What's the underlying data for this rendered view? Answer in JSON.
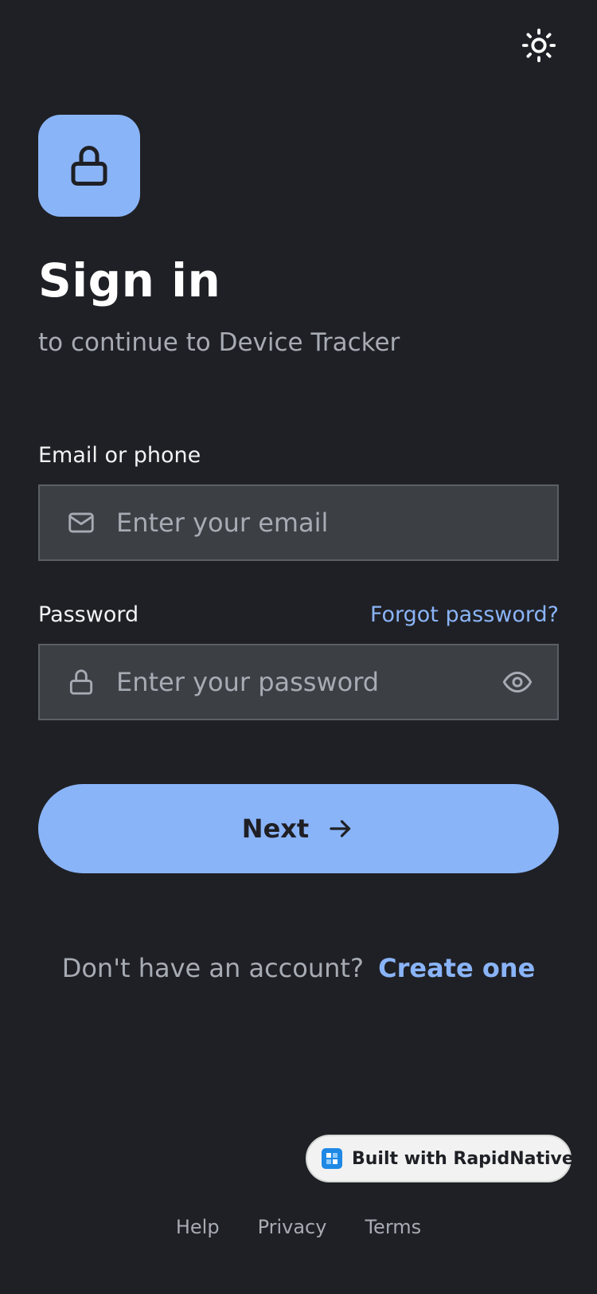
{
  "header": {
    "theme_toggle_icon": "sun-icon"
  },
  "brand": {
    "logo_icon": "lock-icon",
    "accent_color": "#8ab4f8"
  },
  "signin": {
    "title": "Sign in",
    "subtitle": "to continue to Device Tracker"
  },
  "email": {
    "label": "Email or phone",
    "placeholder": "Enter your email",
    "value": "",
    "icon": "mail-icon"
  },
  "password": {
    "label": "Password",
    "placeholder": "Enter your password",
    "value": "",
    "icon": "lock-icon",
    "toggle_icon": "eye-icon",
    "forgot_label": "Forgot password?"
  },
  "primary_action": {
    "label": "Next",
    "icon": "arrow-right-icon"
  },
  "signup": {
    "prompt": "Don't have an account?",
    "link_label": "Create one"
  },
  "badge": {
    "label": "Built with RapidNative"
  },
  "footer": {
    "links": [
      "Help",
      "Privacy",
      "Terms"
    ]
  },
  "colors": {
    "background": "#1f2025",
    "field_background": "#3c4045",
    "muted_text": "#a7abb3"
  }
}
